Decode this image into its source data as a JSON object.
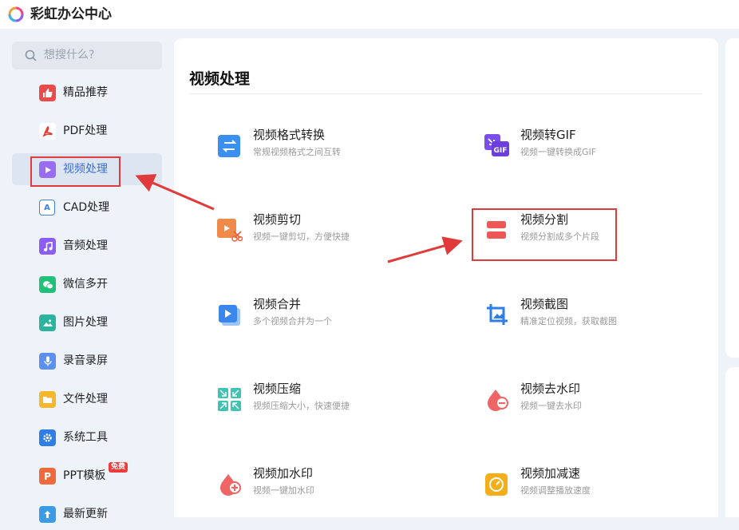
{
  "app": {
    "title": "彩虹办公中心"
  },
  "search": {
    "placeholder": "想搜什么?"
  },
  "sidebar": {
    "items": [
      {
        "label": "精品推荐",
        "icon": "thumbs-up-icon",
        "color": "#ea4a4a"
      },
      {
        "label": "PDF处理",
        "icon": "pdf-icon",
        "color": "#ffffff"
      },
      {
        "label": "视频处理",
        "icon": "play-icon",
        "color": "#9a6cf2"
      },
      {
        "label": "CAD处理",
        "icon": "cad-icon",
        "color": "#3b82e6"
      },
      {
        "label": "音频处理",
        "icon": "music-icon",
        "color": "#8b5cf6"
      },
      {
        "label": "微信多开",
        "icon": "wechat-icon",
        "color": "#22c17a"
      },
      {
        "label": "图片处理",
        "icon": "image-icon",
        "color": "#2bb3a0"
      },
      {
        "label": "录音录屏",
        "icon": "mic-icon",
        "color": "#5b8ff0"
      },
      {
        "label": "文件处理",
        "icon": "folder-icon",
        "color": "#f4b82a"
      },
      {
        "label": "系统工具",
        "icon": "gear-icon",
        "color": "#2f7ee8"
      },
      {
        "label": "PPT模板",
        "icon": "ppt-icon",
        "color": "#ee6a3c",
        "badge": "免费"
      },
      {
        "label": "最新更新",
        "icon": "update-icon",
        "color": "#3b9be6"
      }
    ]
  },
  "main": {
    "title": "视频处理",
    "tools": [
      {
        "name": "视频格式转换",
        "desc": "常规视频格式之间互转",
        "icon": "swap-icon"
      },
      {
        "name": "视频转GIF",
        "desc": "视频一键转换成GIF",
        "icon": "gif-icon"
      },
      {
        "name": "视频剪切",
        "desc": "视频一键剪切，方便快捷",
        "icon": "cut-icon"
      },
      {
        "name": "视频分割",
        "desc": "视频分割成多个片段",
        "icon": "split-icon"
      },
      {
        "name": "视频合并",
        "desc": "多个视频合并为一个",
        "icon": "merge-icon"
      },
      {
        "name": "视频截图",
        "desc": "精准定位视频，获取截图",
        "icon": "crop-icon"
      },
      {
        "name": "视频压缩",
        "desc": "视频压缩大小，快速便捷",
        "icon": "compress-icon"
      },
      {
        "name": "视频去水印",
        "desc": "视频一键去水印",
        "icon": "remove-watermark-icon"
      },
      {
        "name": "视频加水印",
        "desc": "视频一键加水印",
        "icon": "add-watermark-icon"
      },
      {
        "name": "视频加减速",
        "desc": "视频调整播放速度",
        "icon": "speed-icon"
      }
    ]
  },
  "colors": {
    "accent": "#3a6fd8",
    "annotation": "#e03a3a"
  }
}
